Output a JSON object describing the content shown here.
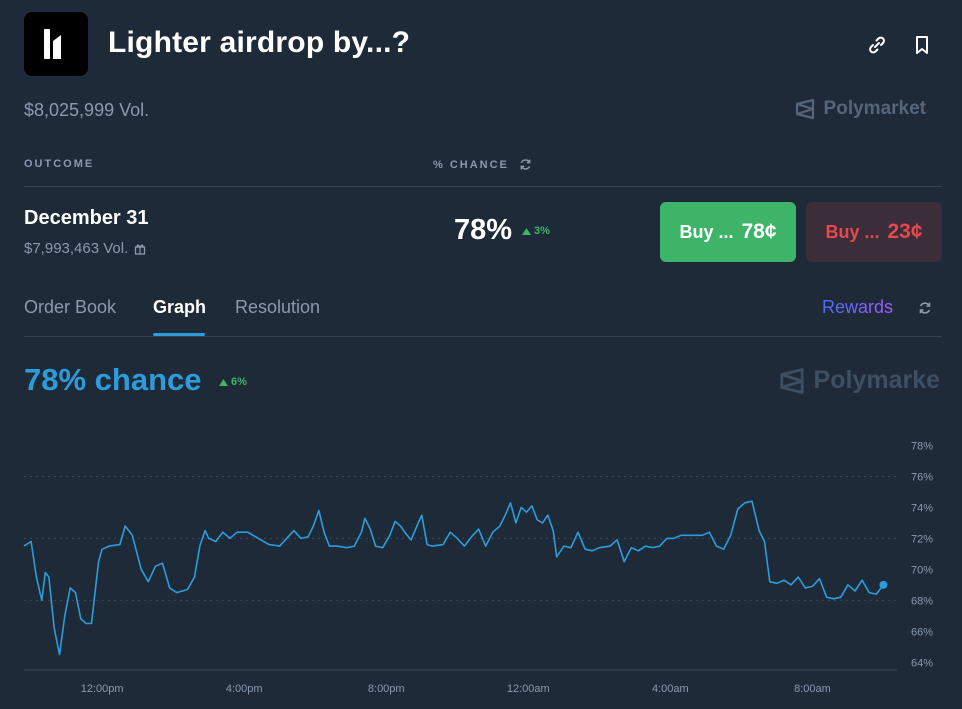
{
  "market": {
    "title": "Lighter airdrop by...?",
    "volume": "$8,025,999 Vol.",
    "brand": "Polymarket"
  },
  "table": {
    "outcome_header": "OUTCOME",
    "chance_header": "% CHANCE"
  },
  "outcome": {
    "name": "December 31",
    "volume": "$7,993,463 Vol.",
    "percent": "78%",
    "delta": "3%",
    "buy_yes_label": "Buy ...",
    "buy_yes_price": "78¢",
    "buy_no_label": "Buy ...",
    "buy_no_price": "23¢"
  },
  "tabs": [
    {
      "label": "Order Book",
      "active": false
    },
    {
      "label": "Graph",
      "active": true
    },
    {
      "label": "Resolution",
      "active": false
    }
  ],
  "rewards_label": "Rewards",
  "graph": {
    "chance_text": "78% chance",
    "delta": "6%",
    "watermark": "Polymarke"
  },
  "colors": {
    "background": "#1e2a38",
    "accent": "#2d9cdb",
    "green": "#3db468",
    "red": "#e5484d"
  },
  "chart_data": {
    "type": "line",
    "x_ticks": [
      "12:00pm",
      "4:00pm",
      "8:00pm",
      "12:00am",
      "4:00am",
      "8:00am"
    ],
    "y_ticks": [
      "78%",
      "76%",
      "74%",
      "72%",
      "70%",
      "68%",
      "66%",
      "64%"
    ],
    "ylim": [
      63.5,
      79
    ],
    "xlim_hours": [
      0,
      24.3
    ],
    "grid": "dotted horizontal",
    "series": [
      {
        "color": "#2d9cdb",
        "points": [
          [
            0.0,
            71.5
          ],
          [
            0.2,
            71.8
          ],
          [
            0.35,
            69.5
          ],
          [
            0.5,
            68.0
          ],
          [
            0.6,
            69.8
          ],
          [
            0.7,
            69.5
          ],
          [
            0.85,
            66.2
          ],
          [
            1.0,
            64.5
          ],
          [
            1.15,
            67.0
          ],
          [
            1.3,
            68.8
          ],
          [
            1.45,
            68.5
          ],
          [
            1.6,
            66.8
          ],
          [
            1.75,
            66.5
          ],
          [
            1.9,
            66.5
          ],
          [
            2.0,
            68.5
          ],
          [
            2.1,
            70.5
          ],
          [
            2.2,
            71.3
          ],
          [
            2.4,
            71.5
          ],
          [
            2.7,
            71.6
          ],
          [
            2.85,
            72.8
          ],
          [
            3.05,
            72.2
          ],
          [
            3.3,
            70.0
          ],
          [
            3.5,
            69.2
          ],
          [
            3.7,
            70.2
          ],
          [
            3.9,
            70.4
          ],
          [
            4.1,
            68.8
          ],
          [
            4.3,
            68.5
          ],
          [
            4.6,
            68.7
          ],
          [
            4.8,
            69.5
          ],
          [
            4.95,
            71.5
          ],
          [
            5.1,
            72.5
          ],
          [
            5.2,
            72.0
          ],
          [
            5.4,
            71.8
          ],
          [
            5.6,
            72.4
          ],
          [
            5.8,
            72.0
          ],
          [
            6.0,
            72.4
          ],
          [
            6.3,
            72.4
          ],
          [
            6.6,
            72.0
          ],
          [
            6.9,
            71.6
          ],
          [
            7.2,
            71.5
          ],
          [
            7.6,
            72.5
          ],
          [
            7.8,
            72.0
          ],
          [
            8.0,
            72.1
          ],
          [
            8.15,
            72.8
          ],
          [
            8.3,
            73.8
          ],
          [
            8.45,
            72.4
          ],
          [
            8.6,
            71.5
          ],
          [
            8.8,
            71.5
          ],
          [
            9.1,
            71.4
          ],
          [
            9.3,
            71.5
          ],
          [
            9.5,
            72.4
          ],
          [
            9.6,
            73.3
          ],
          [
            9.75,
            72.6
          ],
          [
            9.9,
            71.5
          ],
          [
            10.1,
            71.4
          ],
          [
            10.3,
            72.2
          ],
          [
            10.45,
            73.1
          ],
          [
            10.6,
            72.8
          ],
          [
            10.75,
            72.3
          ],
          [
            10.9,
            71.9
          ],
          [
            11.1,
            73.0
          ],
          [
            11.2,
            73.5
          ],
          [
            11.35,
            71.6
          ],
          [
            11.5,
            71.5
          ],
          [
            11.8,
            71.6
          ],
          [
            12.0,
            72.4
          ],
          [
            12.2,
            72.0
          ],
          [
            12.4,
            71.5
          ],
          [
            12.6,
            72.1
          ],
          [
            12.8,
            72.6
          ],
          [
            13.0,
            71.5
          ],
          [
            13.2,
            72.4
          ],
          [
            13.4,
            72.8
          ],
          [
            13.55,
            73.5
          ],
          [
            13.7,
            74.3
          ],
          [
            13.85,
            73.0
          ],
          [
            14.0,
            74.0
          ],
          [
            14.15,
            73.7
          ],
          [
            14.3,
            74.1
          ],
          [
            14.45,
            73.2
          ],
          [
            14.6,
            73.0
          ],
          [
            14.75,
            73.5
          ],
          [
            14.9,
            72.5
          ],
          [
            15.0,
            70.8
          ],
          [
            15.2,
            71.5
          ],
          [
            15.4,
            71.4
          ],
          [
            15.6,
            72.4
          ],
          [
            15.8,
            71.3
          ],
          [
            16.0,
            71.2
          ],
          [
            16.2,
            71.4
          ],
          [
            16.5,
            71.5
          ],
          [
            16.7,
            71.9
          ],
          [
            16.9,
            70.5
          ],
          [
            17.1,
            71.4
          ],
          [
            17.3,
            71.2
          ],
          [
            17.5,
            71.5
          ],
          [
            17.7,
            71.4
          ],
          [
            17.9,
            71.5
          ],
          [
            18.1,
            72.0
          ],
          [
            18.3,
            72.0
          ],
          [
            18.5,
            72.2
          ],
          [
            18.8,
            72.2
          ],
          [
            19.1,
            72.2
          ],
          [
            19.3,
            72.4
          ],
          [
            19.5,
            71.5
          ],
          [
            19.7,
            71.3
          ],
          [
            19.9,
            72.2
          ],
          [
            20.1,
            73.9
          ],
          [
            20.3,
            74.3
          ],
          [
            20.5,
            74.4
          ],
          [
            20.7,
            72.5
          ],
          [
            20.85,
            71.8
          ],
          [
            21.0,
            69.2
          ],
          [
            21.2,
            69.1
          ],
          [
            21.4,
            69.3
          ],
          [
            21.6,
            69.0
          ],
          [
            21.8,
            69.5
          ],
          [
            22.0,
            68.8
          ],
          [
            22.2,
            68.9
          ],
          [
            22.4,
            69.4
          ],
          [
            22.6,
            68.2
          ],
          [
            22.8,
            68.1
          ],
          [
            23.0,
            68.2
          ],
          [
            23.2,
            69.0
          ],
          [
            23.4,
            68.6
          ],
          [
            23.6,
            69.3
          ],
          [
            23.8,
            68.5
          ],
          [
            24.0,
            68.4
          ],
          [
            24.2,
            69.0
          ]
        ]
      }
    ]
  }
}
